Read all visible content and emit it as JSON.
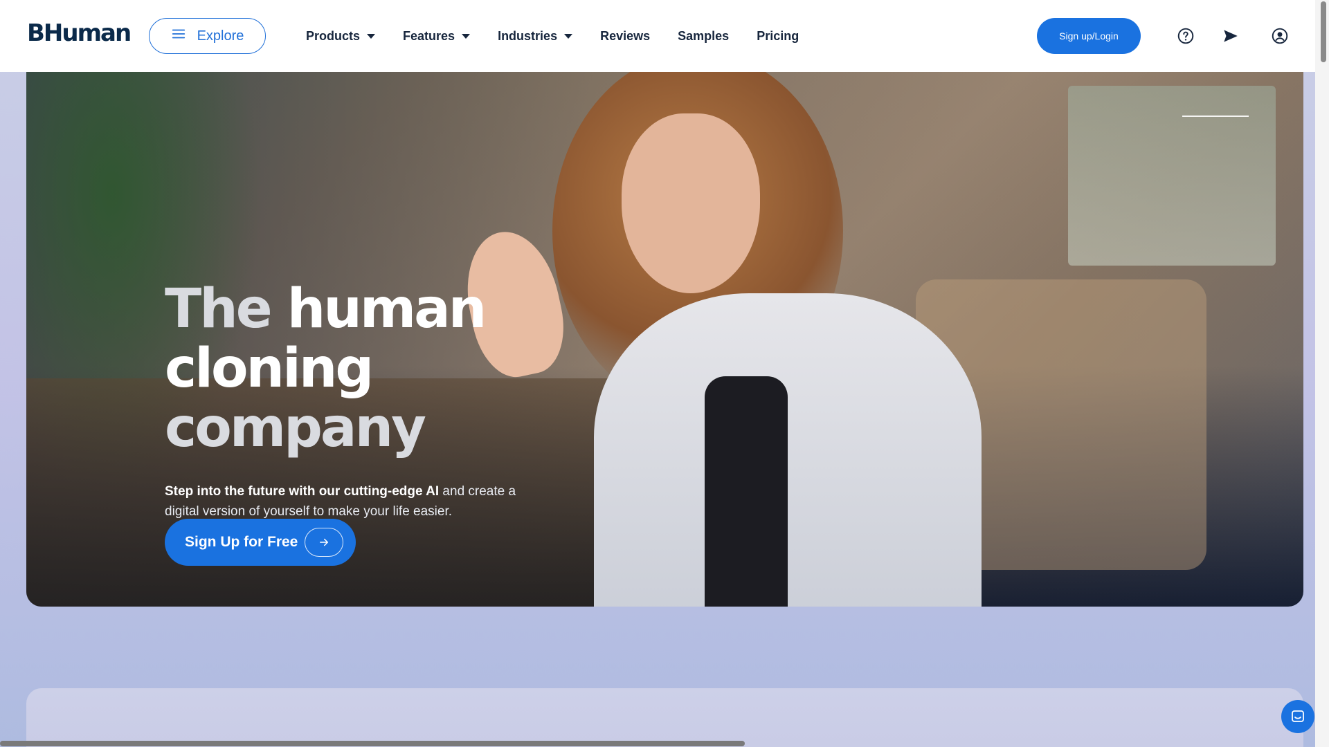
{
  "brand": {
    "logo_text": "BHuman",
    "accent": "#1a72e0"
  },
  "nav": {
    "explore_label": "Explore",
    "items": [
      {
        "label": "Products",
        "dropdown": true
      },
      {
        "label": "Features",
        "dropdown": true
      },
      {
        "label": "Industries",
        "dropdown": true
      },
      {
        "label": "Reviews",
        "dropdown": false
      },
      {
        "label": "Samples",
        "dropdown": false
      },
      {
        "label": "Pricing",
        "dropdown": false
      }
    ],
    "signup_label": "Sign up/Login",
    "icons": [
      "help-circle-icon",
      "send-icon",
      "user-account-icon"
    ]
  },
  "hero": {
    "title_dim_1": "The ",
    "title_bright": "human cloning",
    "title_dim_2": "company",
    "subtitle_strong": "Step into the future with our cutting-edge AI",
    "subtitle_rest": " and create a digital version of yourself to make your life easier.",
    "cta_label": "Sign Up for Free"
  },
  "widgets": {
    "chat_icon": "chat-bubble-icon"
  }
}
